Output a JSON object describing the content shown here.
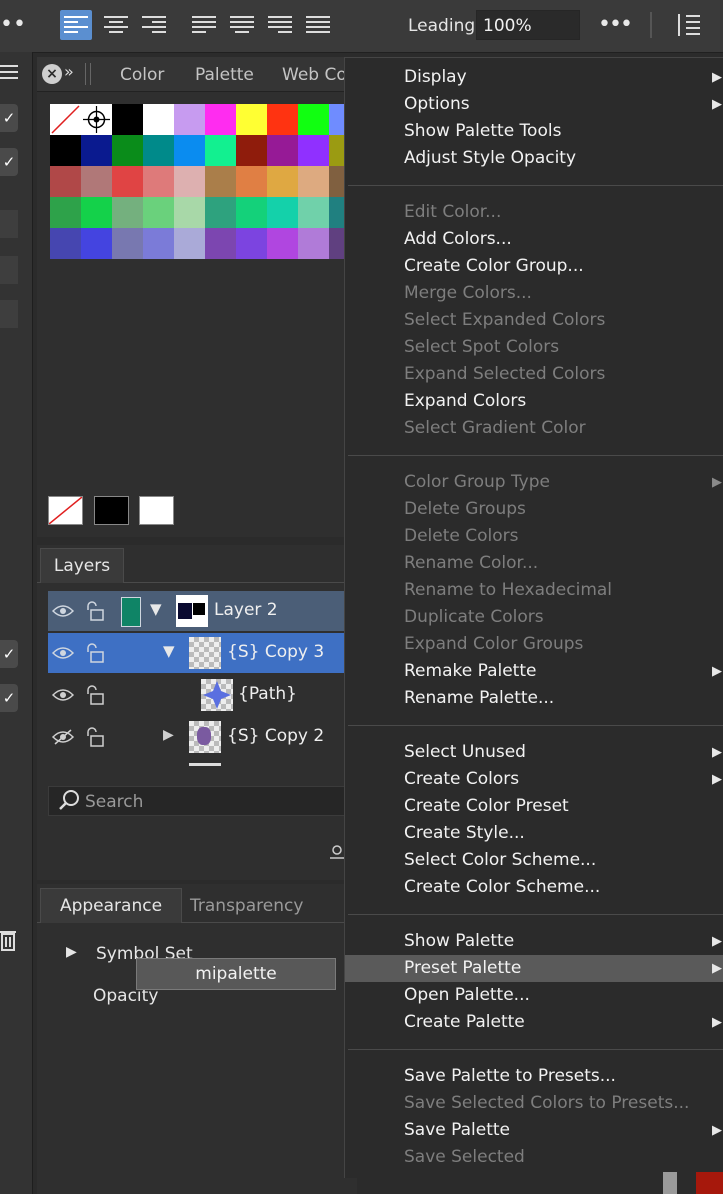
{
  "toolbar": {
    "leading_label": "Leading",
    "leading_value": "100%",
    "more": "•••",
    "left_more": "••"
  },
  "color_panel": {
    "tabs": [
      "Color",
      "Palette",
      "Web Co"
    ],
    "close": "×",
    "collapse": "»"
  },
  "swatches": [
    [
      "none",
      "registration",
      "#000000",
      "#ffffff",
      "#c79bf0",
      "#ff2cf0",
      "#ffff33",
      "#ff3311",
      "#11ff11",
      "#6f8cff"
    ],
    [
      "#000000",
      "#0a1a8f",
      "#0a8c1a",
      "#008a8a",
      "#0a8cf0",
      "#12f090",
      "#8f1c0c",
      "#961a96",
      "#9030ff",
      "#9b9b12"
    ],
    [
      "#b04848",
      "#b07878",
      "#e04444",
      "#de7a7a",
      "#ddb0b0",
      "#aa7e4a",
      "#e07f44",
      "#dfa842",
      "#ddaa80",
      "#806040"
    ],
    [
      "#2ea24a",
      "#14d14a",
      "#74b07e",
      "#6ad17c",
      "#a8d8a8",
      "#2ea27e",
      "#14d17a",
      "#14d1aa",
      "#70d1aa",
      "#208080"
    ],
    [
      "#4646b0",
      "#4444e0",
      "#7878b0",
      "#7b7bd8",
      "#aaaad8",
      "#7c46b0",
      "#7c44e0",
      "#b046e0",
      "#b07bd8",
      "#604080"
    ]
  ],
  "layers": {
    "tab": "Layers",
    "rows": [
      {
        "name": "Layer 2",
        "hidden": false
      },
      {
        "name": "{S} Copy 3",
        "hidden": false
      },
      {
        "name": "{Path}",
        "hidden": false
      },
      {
        "name": "{S} Copy 2",
        "hidden": true
      }
    ],
    "search_placeholder": "Search"
  },
  "appearance": {
    "tabs": [
      "Appearance",
      "Transparency"
    ],
    "symbol_set": "Symbol Set",
    "opacity": "Opacity",
    "tooltip": "mipalette"
  },
  "menu": {
    "groups": [
      [
        {
          "label": "Display",
          "enabled": true,
          "submenu": true
        },
        {
          "label": "Options",
          "enabled": true,
          "submenu": true
        },
        {
          "label": "Show Palette Tools",
          "enabled": true,
          "submenu": false
        },
        {
          "label": "Adjust Style Opacity",
          "enabled": true,
          "submenu": false
        }
      ],
      [
        {
          "label": "Edit Color...",
          "enabled": false,
          "submenu": false
        },
        {
          "label": "Add Colors...",
          "enabled": true,
          "submenu": false
        },
        {
          "label": "Create Color Group...",
          "enabled": true,
          "submenu": false
        },
        {
          "label": "Merge Colors...",
          "enabled": false,
          "submenu": false
        },
        {
          "label": "Select Expanded Colors",
          "enabled": false,
          "submenu": false
        },
        {
          "label": "Select Spot Colors",
          "enabled": false,
          "submenu": false
        },
        {
          "label": "Expand Selected Colors",
          "enabled": false,
          "submenu": false
        },
        {
          "label": "Expand Colors",
          "enabled": true,
          "submenu": false
        },
        {
          "label": "Select Gradient Color",
          "enabled": false,
          "submenu": false
        }
      ],
      [
        {
          "label": "Color Group Type",
          "enabled": false,
          "submenu": true
        },
        {
          "label": "Delete Groups",
          "enabled": false,
          "submenu": false
        },
        {
          "label": "Delete Colors",
          "enabled": false,
          "submenu": false
        },
        {
          "label": "Rename Color...",
          "enabled": false,
          "submenu": false
        },
        {
          "label": "Rename to Hexadecimal",
          "enabled": false,
          "submenu": false
        },
        {
          "label": "Duplicate Colors",
          "enabled": false,
          "submenu": false
        },
        {
          "label": "Expand Color Groups",
          "enabled": false,
          "submenu": false
        },
        {
          "label": "Remake Palette",
          "enabled": true,
          "submenu": true
        },
        {
          "label": "Rename Palette...",
          "enabled": true,
          "submenu": false
        }
      ],
      [
        {
          "label": "Select Unused",
          "enabled": true,
          "submenu": true
        },
        {
          "label": "Create Colors",
          "enabled": true,
          "submenu": true
        },
        {
          "label": "Create Color Preset",
          "enabled": true,
          "submenu": false
        },
        {
          "label": "Create Style...",
          "enabled": true,
          "submenu": false
        },
        {
          "label": "Select Color Scheme...",
          "enabled": true,
          "submenu": false
        },
        {
          "label": "Create Color Scheme...",
          "enabled": true,
          "submenu": false
        }
      ],
      [
        {
          "label": "Show Palette",
          "enabled": true,
          "submenu": true
        },
        {
          "label": "Preset Palette",
          "enabled": true,
          "submenu": true,
          "highlighted": true
        },
        {
          "label": "Open Palette...",
          "enabled": true,
          "submenu": false
        },
        {
          "label": "Create Palette",
          "enabled": true,
          "submenu": true
        }
      ],
      [
        {
          "label": "Save Palette to Presets...",
          "enabled": true,
          "submenu": false
        },
        {
          "label": "Save Selected Colors to Presets...",
          "enabled": false,
          "submenu": false
        },
        {
          "label": "Save Palette",
          "enabled": true,
          "submenu": true
        },
        {
          "label": "Save Selected",
          "enabled": false,
          "submenu": false
        }
      ]
    ]
  }
}
